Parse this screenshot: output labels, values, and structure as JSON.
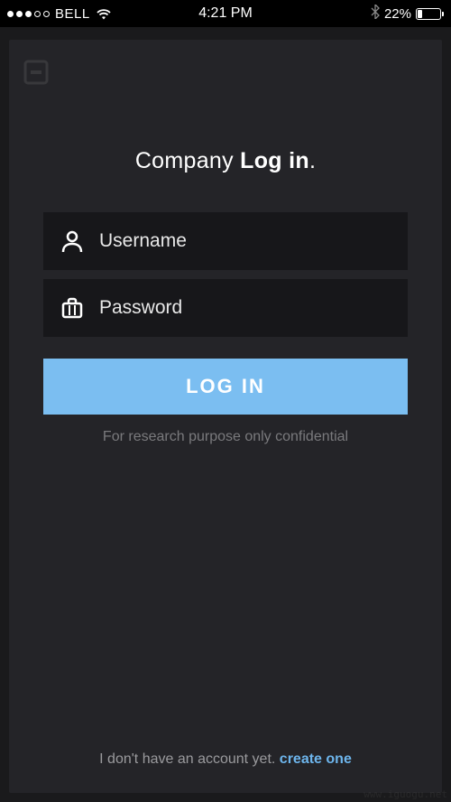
{
  "status_bar": {
    "carrier": "BELL",
    "time": "4:21 PM",
    "battery_percent": "22%"
  },
  "title": {
    "prefix": "Company ",
    "bold": "Log in",
    "suffix": "."
  },
  "form": {
    "username_placeholder": "Username",
    "password_placeholder": "Password",
    "login_button": "LOG IN",
    "disclaimer": "For research purpose only confidential"
  },
  "footer": {
    "text": "I don't have an account yet. ",
    "link": "create one"
  },
  "watermark": "www.iguogu.net",
  "colors": {
    "accent": "#7bbef1",
    "background": "#242428",
    "input_bg": "#17171a"
  }
}
